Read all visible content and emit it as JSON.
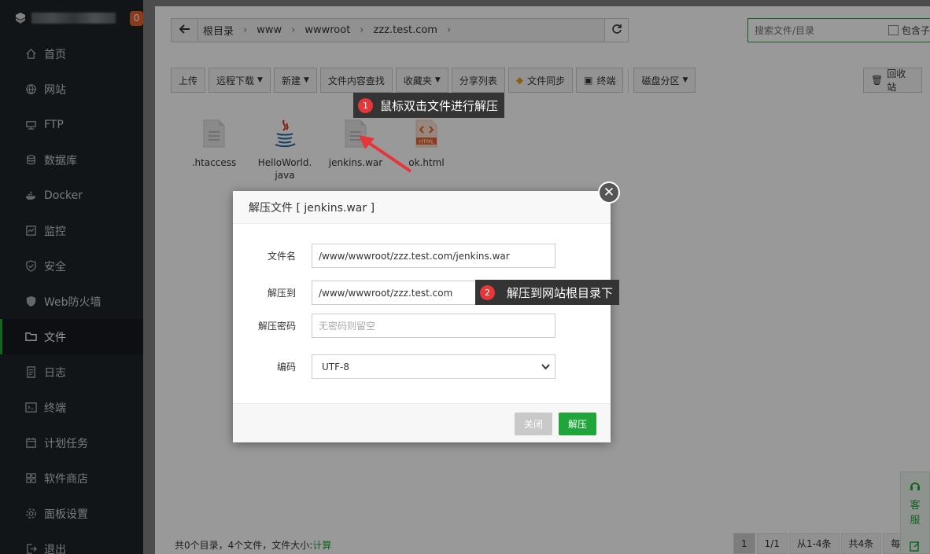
{
  "sidebar": {
    "badge": "0",
    "items": [
      {
        "label": "首页",
        "icon": "home-icon",
        "active": false
      },
      {
        "label": "网站",
        "icon": "globe-icon",
        "active": false
      },
      {
        "label": "FTP",
        "icon": "ftp-icon",
        "active": false
      },
      {
        "label": "数据库",
        "icon": "database-icon",
        "active": false
      },
      {
        "label": "Docker",
        "icon": "docker-icon",
        "active": false
      },
      {
        "label": "监控",
        "icon": "monitor-icon",
        "active": false
      },
      {
        "label": "安全",
        "icon": "shield-icon",
        "active": false
      },
      {
        "label": "Web防火墙",
        "icon": "firewall-icon",
        "active": false
      },
      {
        "label": "文件",
        "icon": "folder-icon",
        "active": true
      },
      {
        "label": "日志",
        "icon": "log-icon",
        "active": false
      },
      {
        "label": "终端",
        "icon": "terminal-icon",
        "active": false
      },
      {
        "label": "计划任务",
        "icon": "calendar-icon",
        "active": false
      },
      {
        "label": "软件商店",
        "icon": "apps-icon",
        "active": false
      },
      {
        "label": "面板设置",
        "icon": "gear-icon",
        "active": false
      },
      {
        "label": "退出",
        "icon": "logout-icon",
        "active": false
      }
    ]
  },
  "path": {
    "crumbs": [
      "根目录",
      "www",
      "wwwroot",
      "zzz.test.com"
    ]
  },
  "search": {
    "placeholder": "搜索文件/目录",
    "include_label": "包含子"
  },
  "toolbar": {
    "upload": "上传",
    "remote_download": "远程下载",
    "new": "新建",
    "content_search": "文件内容查找",
    "favorites": "收藏夹",
    "share_list": "分享列表",
    "file_sync": "文件同步",
    "terminal": "终端",
    "disk_partition": "磁盘分区",
    "recycle_bin": "回收站"
  },
  "files": [
    {
      "name": ".htaccess",
      "icon": "text-file-icon"
    },
    {
      "name": "HelloWorld.\njava",
      "icon": "java-file-icon"
    },
    {
      "name": "jenkins.war",
      "icon": "archive-file-icon"
    },
    {
      "name": "ok.html",
      "icon": "html-file-icon"
    }
  ],
  "footer": {
    "summary": "共0个目录，4个文件，文件大小:",
    "calc": "计算"
  },
  "pager": {
    "current": "1",
    "pages": "1/1",
    "range": "从1-4条",
    "total": "共4条",
    "per_page": "每"
  },
  "side_service": {
    "label1": "客",
    "label2": "服"
  },
  "dialog": {
    "title": "解压文件 [ jenkins.war ]",
    "filename_label": "文件名",
    "filename_value": "/www/wwwroot/zzz.test.com/jenkins.war",
    "extract_to_label": "解压到",
    "extract_to_value": "/www/wwwroot/zzz.test.com",
    "password_label": "解压密码",
    "password_placeholder": "无密码则留空",
    "encoding_label": "编码",
    "encoding_value": "UTF-8",
    "close_button": "关闭",
    "extract_button": "解压"
  },
  "tips": {
    "tip1_num": "1",
    "tip1_text": "鼠标双击文件进行解压",
    "tip2_num": "2",
    "tip2_text": "解压到网站根目录下"
  },
  "colors": {
    "accent": "#20a53a",
    "sidebar_bg": "#1f2429",
    "badge": "#e8622c",
    "tip_num": "#e5373a"
  }
}
